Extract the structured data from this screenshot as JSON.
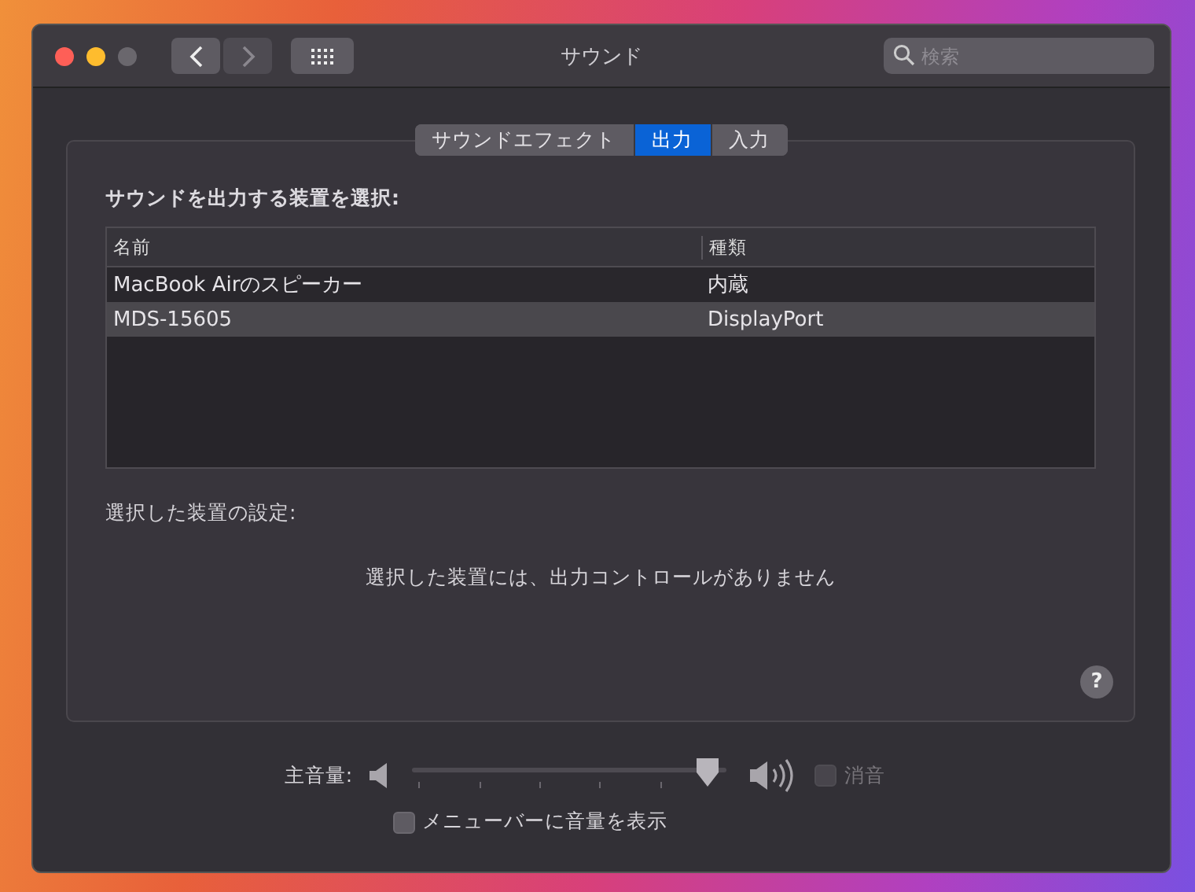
{
  "window": {
    "title": "サウンド"
  },
  "search": {
    "placeholder": "検索"
  },
  "tabs": [
    {
      "label": "サウンドエフェクト",
      "selected": false
    },
    {
      "label": "出力",
      "selected": true
    },
    {
      "label": "入力",
      "selected": false
    }
  ],
  "device_list": {
    "heading": "サウンドを出力する装置を選択:",
    "columns": [
      "名前",
      "種類"
    ],
    "rows": [
      {
        "name": "MacBook Airのスピーカー",
        "type": "内蔵",
        "selected": false
      },
      {
        "name": "MDS-15605",
        "type": "DisplayPort",
        "selected": true
      }
    ]
  },
  "settings": {
    "heading": "選択した装置の設定:",
    "message": "選択した装置には、出力コントロールがありません"
  },
  "help_button": "?",
  "volume": {
    "label": "主音量:",
    "level": 0.96,
    "mute": {
      "label": "消音",
      "checked": false,
      "disabled": true
    }
  },
  "show_in_menu_bar": {
    "label": "メニューバーに音量を表示",
    "checked": false
  }
}
